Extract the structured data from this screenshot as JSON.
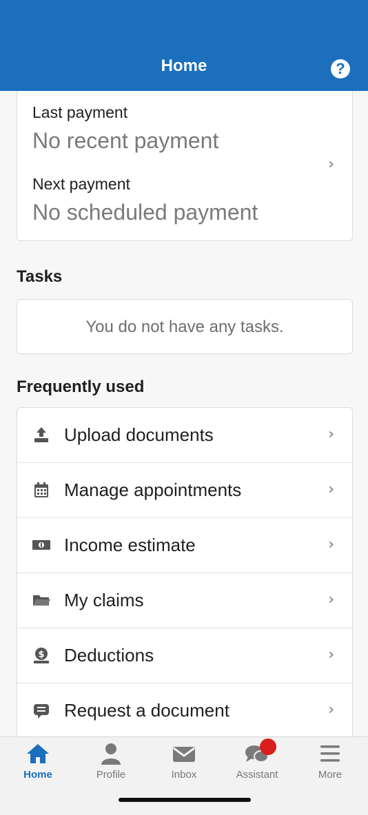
{
  "header": {
    "title": "Home",
    "help_icon": "question-circle-icon"
  },
  "payments": {
    "last_label": "Last payment",
    "last_value": "No recent payment",
    "next_label": "Next payment",
    "next_value": "No scheduled payment"
  },
  "tasks": {
    "title": "Tasks",
    "empty_text": "You do not have any tasks."
  },
  "frequently_used": {
    "title": "Frequently used",
    "items": [
      {
        "label": "Upload documents",
        "icon": "upload-icon"
      },
      {
        "label": "Manage appointments",
        "icon": "calendar-icon"
      },
      {
        "label": "Income estimate",
        "icon": "money-icon"
      },
      {
        "label": "My claims",
        "icon": "folder-icon"
      },
      {
        "label": "Deductions",
        "icon": "deduction-icon"
      },
      {
        "label": "Request a document",
        "icon": "document-request-icon"
      }
    ]
  },
  "tabbar": {
    "tabs": [
      {
        "label": "Home",
        "icon": "home-icon",
        "active": true
      },
      {
        "label": "Profile",
        "icon": "user-icon"
      },
      {
        "label": "Inbox",
        "icon": "envelope-icon"
      },
      {
        "label": "Assistant",
        "icon": "chat-icon",
        "badge": true
      },
      {
        "label": "More",
        "icon": "menu-icon"
      }
    ]
  },
  "colors": {
    "brand": "#1b6fbd",
    "badge": "#d81e1e"
  }
}
